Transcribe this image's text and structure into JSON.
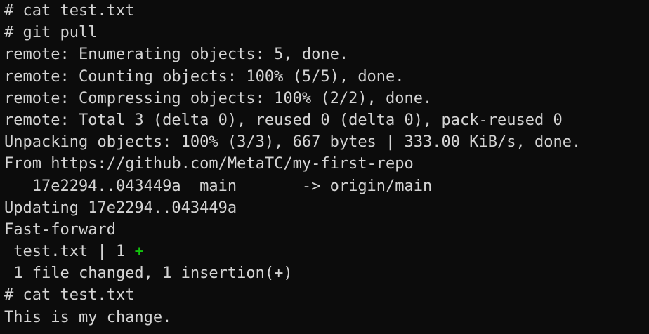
{
  "terminal": {
    "lines": [
      "# cat test.txt",
      "# git pull",
      "remote: Enumerating objects: 5, done.",
      "remote: Counting objects: 100% (5/5), done.",
      "remote: Compressing objects: 100% (2/2), done.",
      "remote: Total 3 (delta 0), reused 0 (delta 0), pack-reused 0",
      "Unpacking objects: 100% (3/3), 667 bytes | 333.00 KiB/s, done.",
      "From https://github.com/MetaTC/my-first-repo",
      "   17e2294..043449a  main       -> origin/main",
      "Updating 17e2294..043449a",
      "Fast-forward",
      " test.txt | 1 ",
      " 1 file changed, 1 insertion(+)",
      "# cat test.txt",
      "This is my change."
    ],
    "diffstat_plus": "+"
  },
  "colors": {
    "background": "#0c0c0c",
    "foreground": "#d4d4d4",
    "diff_plus": "#13c40e"
  }
}
